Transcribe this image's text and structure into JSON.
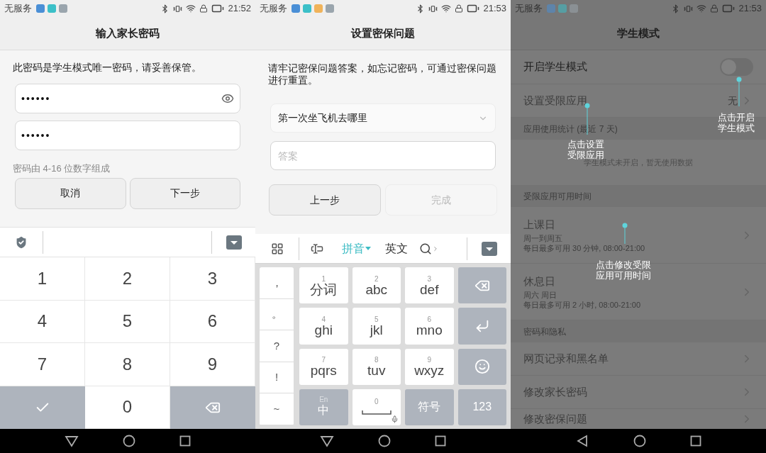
{
  "screens": [
    {
      "kind": "password",
      "status_bar": {
        "carrier": "无服务",
        "time": "21:52"
      },
      "title": "输入家长密码",
      "message": "此密码是学生模式唯一密码，请妥善保管。",
      "fields": [
        {
          "value": "••••••",
          "reveal": true
        },
        {
          "value": "••••••",
          "reveal": false
        }
      ],
      "hint": "密码由 4-16 位数字组成",
      "buttons": [
        {
          "label": "取消",
          "disabled": false
        },
        {
          "label": "下一步",
          "disabled": false
        }
      ],
      "keyboard": {
        "kind": "numeric",
        "keys": [
          {
            "kind": "digit",
            "label": "1"
          },
          {
            "kind": "digit",
            "label": "2"
          },
          {
            "kind": "digit",
            "label": "3"
          },
          {
            "kind": "digit",
            "label": "4"
          },
          {
            "kind": "digit",
            "label": "5"
          },
          {
            "kind": "digit",
            "label": "6"
          },
          {
            "kind": "digit",
            "label": "7"
          },
          {
            "kind": "digit",
            "label": "8"
          },
          {
            "kind": "digit",
            "label": "9"
          },
          {
            "kind": "done"
          },
          {
            "kind": "digit",
            "label": "0"
          },
          {
            "kind": "delete"
          }
        ]
      }
    },
    {
      "kind": "security_question",
      "status_bar": {
        "carrier": "无服务",
        "time": "21:53"
      },
      "title": "设置密保问题",
      "message": "请牢记密保问题答案，如忘记密码，可通过密保问题进行重置。",
      "question": "第一次坐飞机去哪里",
      "answer": {
        "placeholder": "答案"
      },
      "buttons": [
        {
          "label": "上一步",
          "disabled": false
        },
        {
          "label": "完成",
          "disabled": true
        }
      ],
      "keyboard": {
        "kind": "t9",
        "modes": [
          {
            "label": "拼音",
            "selected": true
          },
          {
            "label": "英文",
            "selected": false
          }
        ],
        "symbols": [
          "，",
          "。",
          "?",
          "!",
          "~"
        ],
        "keys": [
          {
            "kind": "t9",
            "number": "1",
            "letters": "分词"
          },
          {
            "kind": "t9",
            "number": "2",
            "letters": "abc"
          },
          {
            "kind": "t9",
            "number": "3",
            "letters": "def"
          },
          {
            "kind": "delete"
          },
          {
            "kind": "t9",
            "number": "4",
            "letters": "ghi"
          },
          {
            "kind": "t9",
            "number": "5",
            "letters": "jkl"
          },
          {
            "kind": "t9",
            "number": "6",
            "letters": "mno"
          },
          {
            "kind": "enter"
          },
          {
            "kind": "t9",
            "number": "7",
            "letters": "pqrs"
          },
          {
            "kind": "t9",
            "number": "8",
            "letters": "tuv"
          },
          {
            "kind": "t9",
            "number": "9",
            "letters": "wxyz"
          },
          {
            "kind": "emoji"
          },
          {
            "kind": "mode",
            "hint": "En",
            "label": "中"
          },
          {
            "kind": "space",
            "number": "0"
          },
          {
            "kind": "mode",
            "label": "符号"
          },
          {
            "kind": "mode",
            "label": "123"
          }
        ]
      }
    },
    {
      "kind": "settings",
      "status_bar": {
        "carrier": "无服务",
        "time": "21:53"
      },
      "title": "学生模式",
      "items": [
        {
          "kind": "toggle",
          "label": "开启学生模式",
          "on": false
        },
        {
          "kind": "link",
          "label": "设置受限应用",
          "value": "无",
          "disabled": true
        },
        {
          "kind": "header",
          "label": "应用使用统计 (最近 7 天)"
        },
        {
          "kind": "empty",
          "text": "学生模式未开启，暂无使用数据"
        },
        {
          "kind": "header",
          "label": "受限应用可用时间"
        },
        {
          "kind": "schedule",
          "label": "上课日",
          "lines": [
            "周一到周五",
            "每日最多可用 30 分钟, 08:00-21:00"
          ],
          "disabled": true
        },
        {
          "kind": "schedule",
          "label": "休息日",
          "lines": [
            "周六 周日",
            "每日最多可用 2 小时, 08:00-21:00"
          ],
          "disabled": true
        },
        {
          "kind": "header",
          "label": "密码和隐私"
        },
        {
          "kind": "link",
          "label": "网页记录和黑名单",
          "disabled": true
        },
        {
          "kind": "link",
          "label": "修改家长密码",
          "disabled": true
        },
        {
          "kind": "link",
          "label": "修改密保问题",
          "disabled": true
        }
      ],
      "annotations": [
        {
          "lines": [
            "点击开启",
            "学生模式"
          ]
        },
        {
          "lines": [
            "点击设置",
            "受限应用"
          ]
        },
        {
          "lines": [
            "点击修改受限",
            "应用可用时间"
          ]
        }
      ]
    }
  ]
}
